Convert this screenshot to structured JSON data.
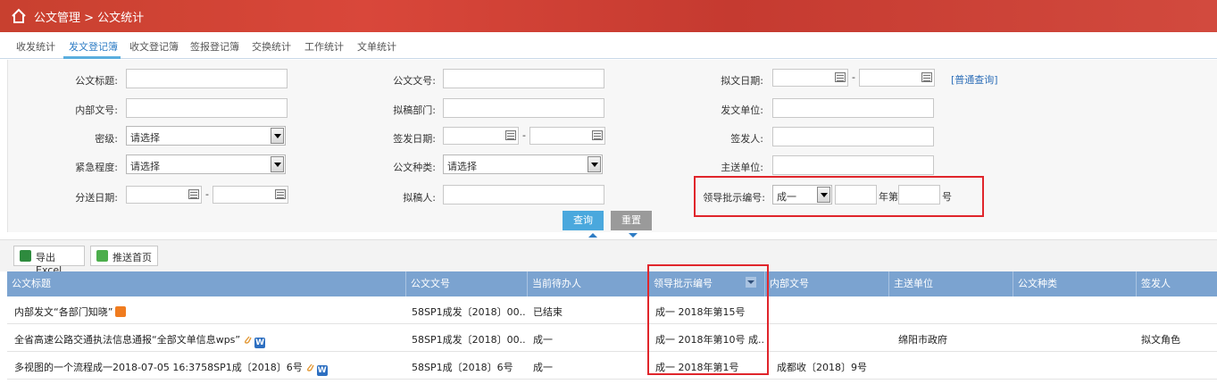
{
  "header": {
    "breadcrumb": "公文管理 > 公文统计"
  },
  "tabs": [
    "收发统计",
    "发文登记簿",
    "收文登记簿",
    "签报登记簿",
    "交换统计",
    "工作统计",
    "文单统计"
  ],
  "form": {
    "title_label": "公文标题:",
    "doc_no_label": "公文文号:",
    "draft_date_label": "拟文日期:",
    "normal_query_link": "[普通查询]",
    "internal_no_label": "内部文号:",
    "draft_dept_label": "拟稿部门:",
    "issuing_unit_label": "发文单位:",
    "security_label": "密级:",
    "security_value": "请选择",
    "sign_date_label": "签发日期:",
    "signer_label": "签发人:",
    "urgency_label": "紧急程度:",
    "urgency_value": "请选择",
    "doc_type_label": "公文种类:",
    "doc_type_value": "请选择",
    "main_unit_label": "主送单位:",
    "dispatch_date_label": "分送日期:",
    "drafter_label": "拟稿人:",
    "leader_no_label": "领导批示编号:",
    "leader_no_prefix": "成一",
    "year_suffix": "年第",
    "num_suffix": "号",
    "dash": "-",
    "query_button": "查询",
    "reset_button": "重置"
  },
  "toolbar": {
    "export_label": "导出Excel",
    "push_label": "推送首页"
  },
  "columns": [
    "公文标题",
    "公文文号",
    "当前待办人",
    "领导批示编号",
    "内部文号",
    "主送单位",
    "公文种类",
    "签发人"
  ],
  "rows": [
    {
      "title": "内部发文“各部门知晓”",
      "doc_no": "58SP1成发〔2018〕00...",
      "todo": "已结束",
      "leader_no": "成一 2018年第15号",
      "internal_no": "",
      "main_unit": "",
      "doc_type": "",
      "signer": ""
    },
    {
      "title": "全省高速公路交通执法信息通报“全部文单信息wps”",
      "doc_no": "58SP1成发〔2018〕00...",
      "todo": "成一",
      "leader_no": "成一 2018年第10号 成...",
      "internal_no": "",
      "main_unit": "绵阳市政府",
      "doc_type": "",
      "signer": "拟文角色"
    },
    {
      "title": "多视图的一个流程成一2018-07-05 16:3758SP1成〔2018〕6号",
      "doc_no": "58SP1成〔2018〕6号",
      "todo": "成一",
      "leader_no": "成一 2018年第1号",
      "internal_no": "成都收〔2018〕9号",
      "main_unit": "",
      "doc_type": "",
      "signer": ""
    }
  ],
  "colors": {
    "header_red": "#c8402f",
    "grid_header": "#7ba3d0",
    "accent_blue": "#4aa8dd",
    "highlight_red": "#e0252b"
  }
}
